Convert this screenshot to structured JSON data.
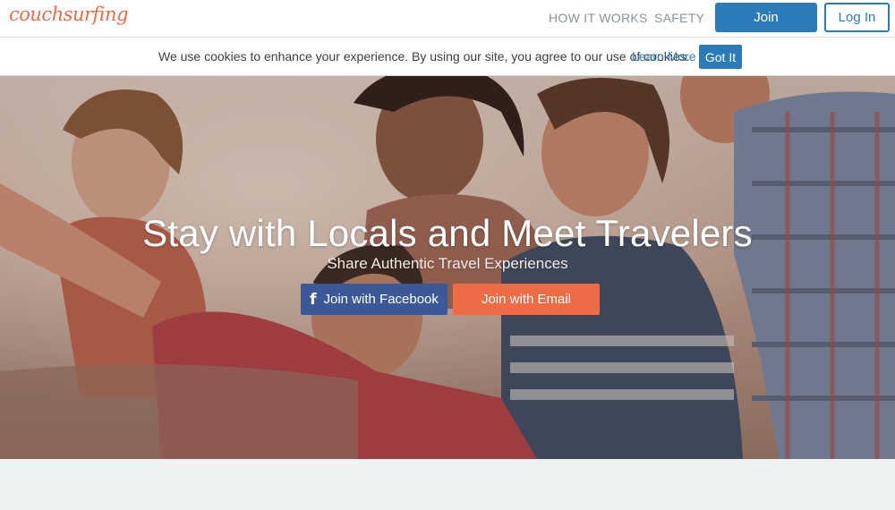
{
  "header": {
    "logo_text": "couchsurfing",
    "nav": {
      "how_it_works": "HOW IT WORKS",
      "safety": "SAFETY"
    },
    "join_label": "Join",
    "login_label": "Log In"
  },
  "cookie_bar": {
    "message": "We use cookies to enhance your experience. By using our site, you agree to our use of cookies.",
    "learn_more": "Learn More",
    "got_it": "Got It"
  },
  "hero": {
    "title": "Stay with Locals and Meet Travelers",
    "subtitle": "Share Authentic Travel Experiences",
    "facebook_button": "Join with Facebook",
    "facebook_icon": "facebook-icon",
    "email_button": "Join with Email"
  },
  "colors": {
    "brand_orange": "#ed6b45",
    "brand_blue": "#2b7bb9",
    "facebook_blue": "#3b5998"
  }
}
